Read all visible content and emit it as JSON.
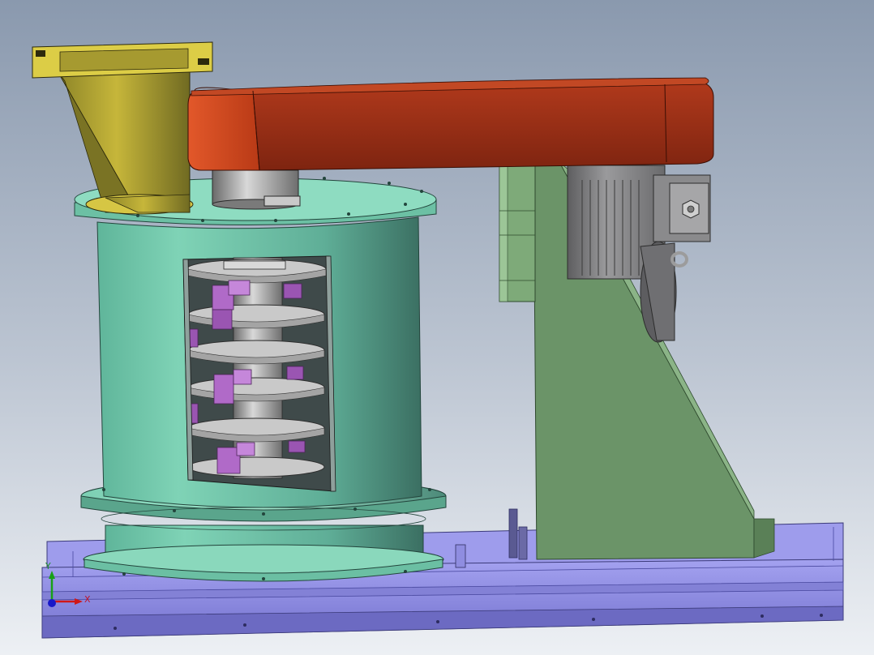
{
  "viewport": {
    "colors": {
      "background_top": "#8898ae",
      "background_bottom": "#eef0f4",
      "base_frame": "#8f8de6",
      "base_frame_dark": "#6e6cc8",
      "housing": "#72c9ac",
      "housing_dark": "#3d7f6c",
      "flange": "#8ddcc0",
      "belt_guard": "#b0381e",
      "belt_guard_front": "#d2451f",
      "hopper": "#c9b93d",
      "hopper_dark": "#6e6a2a",
      "motor_bracket": "#6f9a6c",
      "motor": "#8c8c8c",
      "rotor_disc": "#c8c8c8",
      "hammer": "#b06ac8"
    }
  },
  "triad": {
    "x_label": "X",
    "y_label": "Y",
    "x_color": "#d01818",
    "y_color": "#18a018",
    "z_color": "#1818c8"
  }
}
